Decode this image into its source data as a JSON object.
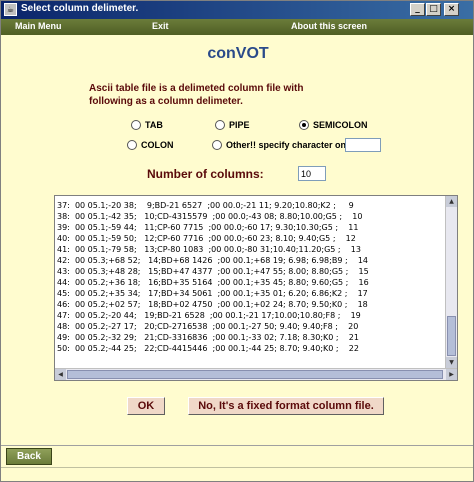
{
  "window": {
    "title": "Select column delimeter.",
    "controls": {
      "minimize": "_",
      "maximize": "□",
      "close": "×"
    }
  },
  "menu": {
    "main_menu": "Main Menu",
    "exit": "Exit",
    "about": "About this screen"
  },
  "app_title": "conVOT",
  "description": {
    "line1": "Ascii table file is a delimeted column file with",
    "line2": "following as a column delimeter."
  },
  "delimiters": {
    "tab": "TAB",
    "pipe": "PIPE",
    "semicolon": "SEMICOLON",
    "colon": "COLON",
    "other": "Other!! specify character only",
    "selected": "SEMICOLON",
    "other_value": ""
  },
  "num_columns": {
    "label": "Number of columns:",
    "value": "10"
  },
  "data_lines": [
    "37:  00 05.1;-20 38;    9;BD-21 6527  ;00 00.0;-21 11; 9.20;10.80;K2 ;     9",
    "38:  00 05.1;-42 35;   10;CD-4315579  ;00 00.0;-43 08; 8.80;10.00;G5 ;    10",
    "39:  00 05.1;-59 44;   11;CP-60 7715  ;00 00.0;-60 17; 9.30;10.30;G5 ;    11",
    "40:  00 05.1;-59 50;   12;CP-60 7716  ;00 00.0;-60 23; 8.10; 9.40;G5 ;    12",
    "41:  00 05.1;-79 58;   13;CP-80 1083  ;00 00.0;-80 31;10.40;11.20;G5 ;    13",
    "42:  00 05.3;+68 52;   14;BD+68 1426  ;00 00.1;+68 19; 6.98; 6.98;B9 ;    14",
    "43:  00 05.3;+48 28;   15;BD+47 4377  ;00 00.1;+47 55; 8.00; 8.80;G5 ;    15",
    "44:  00 05.2;+36 18;   16;BD+35 5164  ;00 00.1;+35 45; 8.80; 9.60;G5 ;    16",
    "45:  00 05.2;+35 34;   17;BD+34 5061  ;00 00.1;+35 01; 6.20; 6.86;K2 ;    17",
    "46:  00 05.2;+02 57;   18;BD+02 4750  ;00 00.1;+02 24; 8.70; 9.50;K0 ;    18",
    "47:  00 05.2;-20 44;   19;BD-21 6528  ;00 00.1;-21 17;10.00;10.80;F8 ;    19",
    "48:  00 05.2;-27 17;   20;CD-2716538  ;00 00.1;-27 50; 9.40; 9.40;F8 ;    20",
    "49:  00 05.2;-32 29;   21;CD-3316836  ;00 00.1;-33 02; 7.18; 8.30;K0 ;    21",
    "50:  00 05.2;-44 25;   22;CD-4415446  ;00 00.1;-44 25; 8.70; 9.40;K0 ;    22"
  ],
  "buttons": {
    "ok": "OK",
    "fixed": "No, It's a fixed format column file.",
    "back": "Back"
  },
  "colors": {
    "background": "#fffccf",
    "menu_bar": "#5a6a2a",
    "title_text": "#2a4a8a",
    "label_text": "#5a0a0a"
  }
}
